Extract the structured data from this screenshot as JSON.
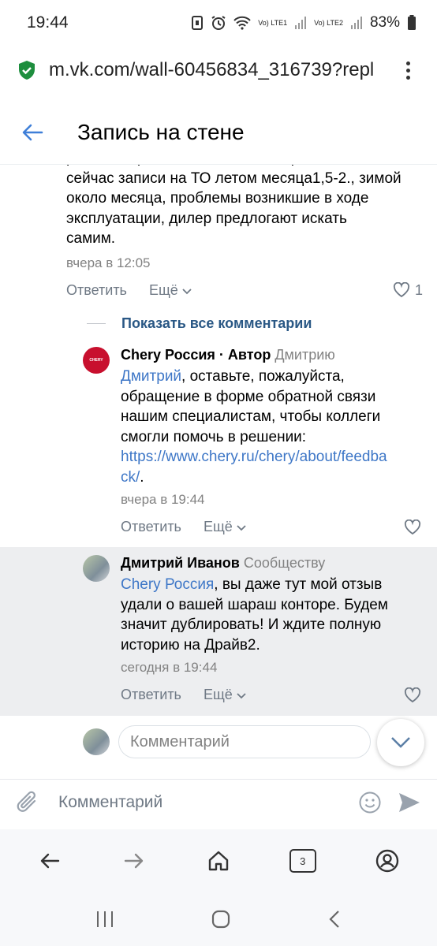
{
  "status": {
    "time": "19:44",
    "battery": "83%",
    "sim1": "Vo) LTE1",
    "sim2": "Vo) LTE2"
  },
  "browser": {
    "url": "m.vk.com/wall-60456834_316739?repl"
  },
  "header": {
    "title": "Запись на стене"
  },
  "top_comment": {
    "lines": [
      "работы сервисов в выявлении проблем,",
      "сейчас записи на ТО летом месяца1,5-2., зимой",
      "около месяца, проблемы возникшие в ходе",
      "эксплуатации, дилер предлогают искать",
      "самим."
    ],
    "time": "вчера в 12:05",
    "reply": "Ответить",
    "more": "Ещё",
    "likes": "1"
  },
  "show_all": "Показать все комментарии",
  "comment1": {
    "author": "Chery Россия · Автор",
    "to": "Дмитрию",
    "mention": "Дмитрий",
    "text_after_mention": ", оставьте, пожалуйста,",
    "lines": [
      "обращение в форме обратной связи",
      "нашим специалистам, чтобы коллеги",
      "смогли помочь в решении:"
    ],
    "link_line1": "https://www.chery.ru/chery/about/feedba",
    "link_line2": "ck/",
    "after_link": ".",
    "time": "вчера в 19:44",
    "reply": "Ответить",
    "more": "Ещё",
    "avatar_text": "CHERY"
  },
  "comment2": {
    "author": "Дмитрий Иванов",
    "to": "Сообществу",
    "mention": "Chery Россия",
    "text_after_mention": ", вы даже тут мой отзыв",
    "lines": [
      "удали о вашей шараш конторе. Будем",
      "значит дублировать! И ждите полную",
      "историю на Драйв2."
    ],
    "time": "сегодня в 19:44",
    "reply": "Ответить",
    "more": "Ещё"
  },
  "inline_comment": {
    "placeholder": "Комментарий"
  },
  "composer": {
    "placeholder": "Комментарий"
  },
  "tabs_count": "3",
  "colors": {
    "link": "#2a5885",
    "mention": "#3e77c7",
    "highlight_bg": "#edeef0",
    "chery_red": "#c8102e"
  }
}
